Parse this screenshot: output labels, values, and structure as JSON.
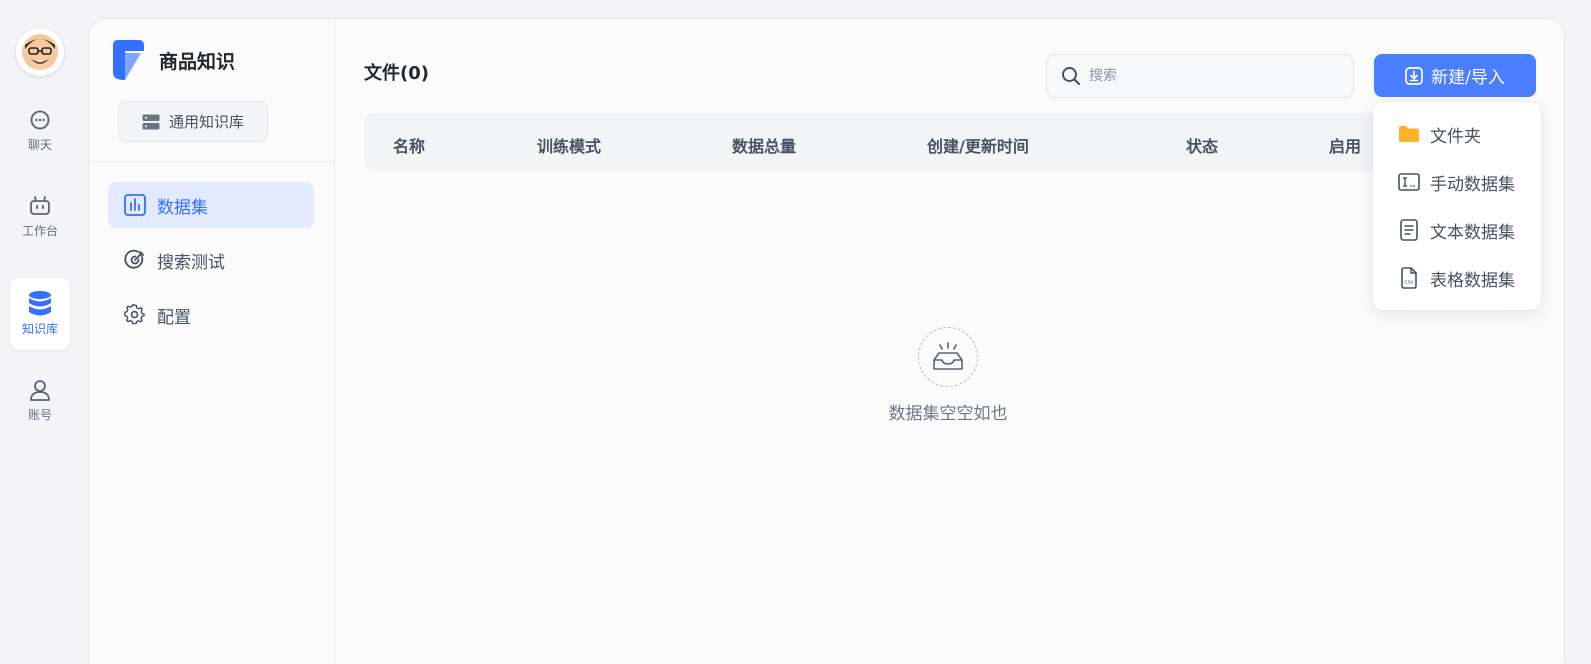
{
  "nav": {
    "items": [
      {
        "label": "聊天",
        "icon": "chat-icon"
      },
      {
        "label": "工作台",
        "icon": "robot-icon"
      },
      {
        "label": "知识库",
        "icon": "database-icon",
        "active": true
      },
      {
        "label": "账号",
        "icon": "user-icon"
      }
    ]
  },
  "kb": {
    "title": "商品知识",
    "type_label": "通用知识库"
  },
  "sidebar": {
    "items": [
      {
        "label": "数据集",
        "icon": "chart-icon",
        "active": true
      },
      {
        "label": "搜索测试",
        "icon": "target-icon"
      },
      {
        "label": "配置",
        "icon": "gear-icon"
      }
    ]
  },
  "main": {
    "title": "文件(0)",
    "search_placeholder": "搜索",
    "new_button": "新建/导入",
    "columns": [
      "名称",
      "训练模式",
      "数据总量",
      "创建/更新时间",
      "状态",
      "启用"
    ],
    "empty_text": "数据集空空如也"
  },
  "dropdown": {
    "items": [
      {
        "label": "文件夹",
        "icon": "folder-icon"
      },
      {
        "label": "手动数据集",
        "icon": "manual-input-icon"
      },
      {
        "label": "文本数据集",
        "icon": "text-file-icon"
      },
      {
        "label": "表格数据集",
        "icon": "csv-file-icon"
      }
    ]
  },
  "colors": {
    "accent": "#3370ff",
    "button": "#4a7eff",
    "folder": "#ffb12a",
    "text": "#485264"
  }
}
